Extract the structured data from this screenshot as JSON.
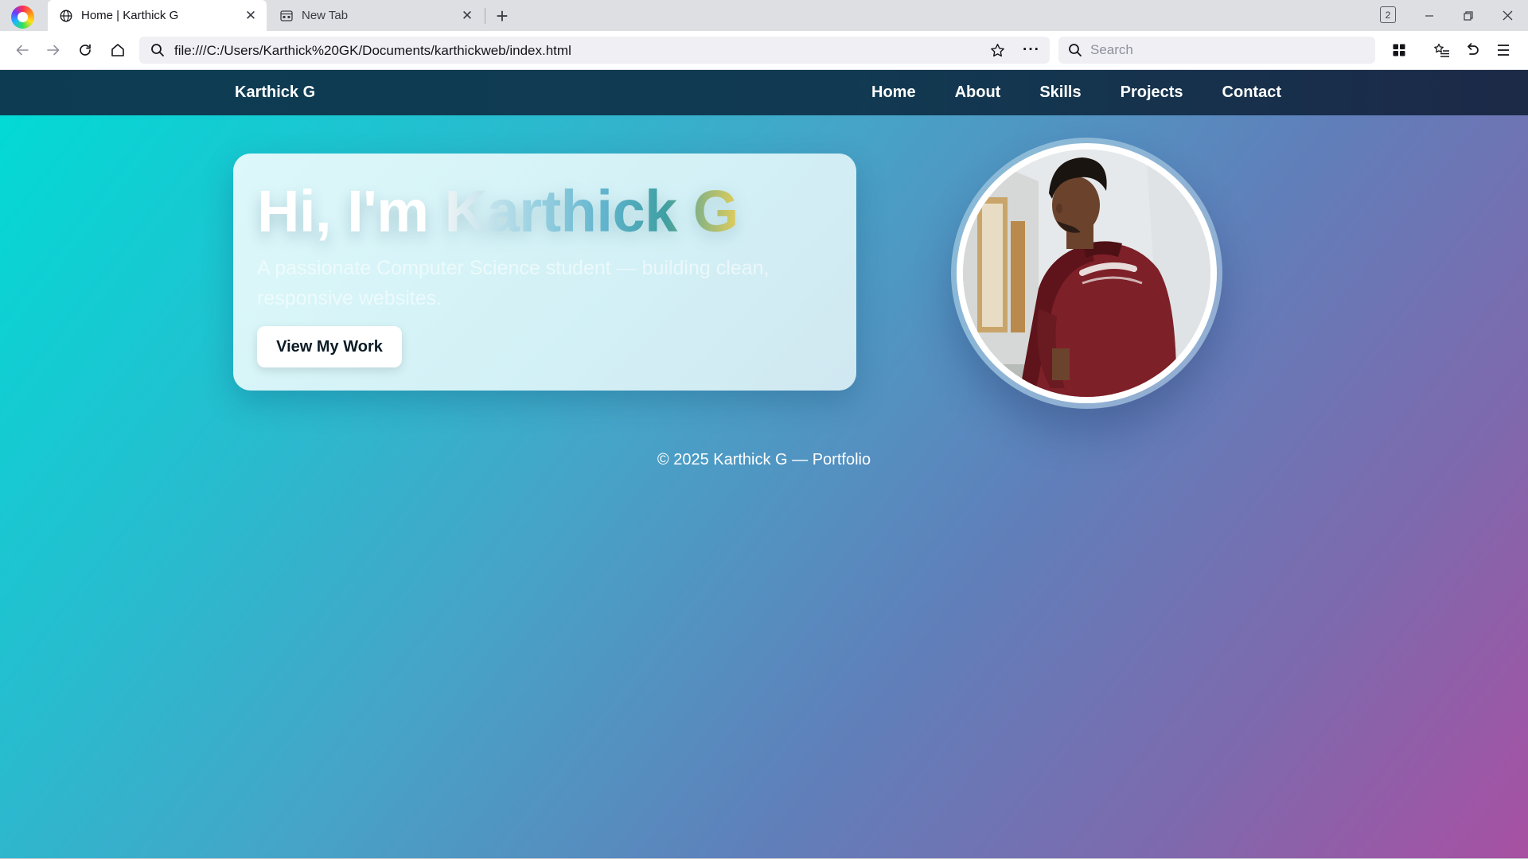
{
  "browser": {
    "tabs": [
      {
        "title": "Home | Karthick G",
        "active": true,
        "icon": "globe-icon"
      },
      {
        "title": "New Tab",
        "active": false,
        "icon": "newtab-page-icon"
      }
    ],
    "tab_count": "2",
    "url": "file:///C:/Users/Karthick%20GK/Documents/karthickweb/index.html",
    "search_placeholder": "Search"
  },
  "site": {
    "brand": "Karthick G",
    "nav": [
      "Home",
      "About",
      "Skills",
      "Projects",
      "Contact"
    ],
    "hero": {
      "greeting": "Hi, I'm ",
      "name": "Karthick G",
      "subtitle": "A passionate Computer Science student — building clean, responsive websites.",
      "cta_label": "View My Work"
    },
    "avatar": {
      "shirt_text": "Palm Angels"
    },
    "footer": "© 2025 Karthick G — Portfolio"
  },
  "colors": {
    "gradient_start": "#00dcd6",
    "gradient_mid": "#607fba",
    "gradient_end": "#a850a2",
    "nav_bg": "#0d3c52",
    "button_bg": "#ffffff"
  }
}
